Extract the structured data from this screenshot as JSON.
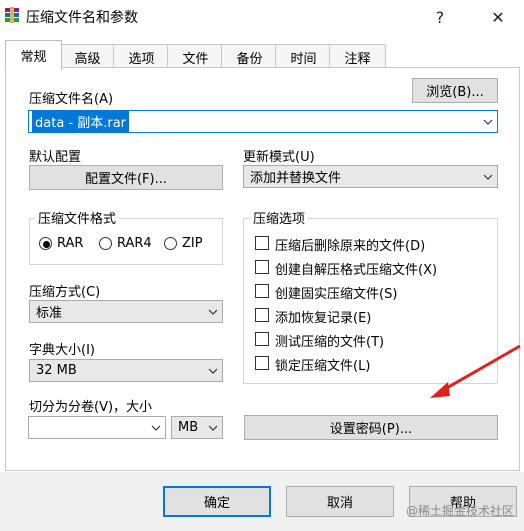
{
  "window": {
    "title": "压缩文件名和参数",
    "help_glyph": "?",
    "close_glyph": "✕"
  },
  "tabs": [
    {
      "label": "常规",
      "active": true
    },
    {
      "label": "高级"
    },
    {
      "label": "选项"
    },
    {
      "label": "文件"
    },
    {
      "label": "备份"
    },
    {
      "label": "时间"
    },
    {
      "label": "注释"
    }
  ],
  "archive_name": {
    "label": "压缩文件名(A)",
    "browse_label": "浏览(B)...",
    "value": "data - 副本.rar"
  },
  "default_profile": {
    "label": "默认配置",
    "button_label": "配置文件(F)..."
  },
  "update_mode": {
    "label": "更新模式(U)",
    "value": "添加并替换文件"
  },
  "archive_format": {
    "label": "压缩文件格式",
    "options": [
      {
        "label": "RAR",
        "selected": true
      },
      {
        "label": "RAR4",
        "selected": false
      },
      {
        "label": "ZIP",
        "selected": false
      }
    ]
  },
  "compression_method": {
    "label": "压缩方式(C)",
    "value": "标准"
  },
  "dictionary_size": {
    "label": "字典大小(I)",
    "value": "32 MB"
  },
  "split_volumes": {
    "label": "切分为分卷(V)，大小",
    "value": "",
    "unit": "MB"
  },
  "archive_options": {
    "label": "压缩选项",
    "items": [
      {
        "label": "压缩后删除原来的文件(D)",
        "checked": false
      },
      {
        "label": "创建自解压格式压缩文件(X)",
        "checked": false
      },
      {
        "label": "创建固实压缩文件(S)",
        "checked": false
      },
      {
        "label": "添加恢复记录(E)",
        "checked": false
      },
      {
        "label": "测试压缩的文件(T)",
        "checked": false
      },
      {
        "label": "锁定压缩文件(L)",
        "checked": false
      }
    ]
  },
  "password_button_label": "设置密码(P)...",
  "footer": {
    "ok_label": "确定",
    "cancel_label": "取消",
    "help_label": "帮助"
  },
  "watermark": "@稀土掘金技术社区",
  "colors": {
    "accent": "#0078d7",
    "arrow": "#e02020"
  }
}
